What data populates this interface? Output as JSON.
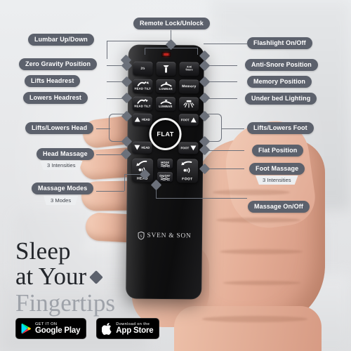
{
  "background": {
    "page_bg": "#e9eaec",
    "accent_pill": "#5c616c"
  },
  "callouts": {
    "top": {
      "label": "Remote Lock/Unlock"
    },
    "left": [
      {
        "label": "Lumbar Up/Down",
        "sub": null
      },
      {
        "label": "Zero Gravity Position",
        "sub": null
      },
      {
        "label": "Lifts Headrest",
        "sub": null
      },
      {
        "label": "Lowers Headrest",
        "sub": null
      },
      {
        "label": "Lifts/Lowers Head",
        "sub": null
      },
      {
        "label": "Head Massage",
        "sub": "3 Intensities"
      },
      {
        "label": "Massage Modes",
        "sub": "3 Modes"
      }
    ],
    "right": [
      {
        "label": "Flashlight On/Off",
        "sub": null
      },
      {
        "label": "Anti-Snore Position",
        "sub": null
      },
      {
        "label": "Memory Position",
        "sub": null
      },
      {
        "label": "Under bed Lighting",
        "sub": null
      },
      {
        "label": "Lifts/Lowers Foot",
        "sub": null
      },
      {
        "label": "Flat Position",
        "sub": null
      },
      {
        "label": "Foot Massage",
        "sub": "3 Intensities"
      },
      {
        "label": "Massage On/Off",
        "sub": null
      }
    ]
  },
  "remote": {
    "lock_indicator": "lock-led",
    "buttons": {
      "zg": "ZG",
      "flashlight": "flashlight-icon",
      "anti_snore_line1": "Anti",
      "anti_snore_line2": "Snore",
      "head_tilt_up": "HEAD TILT",
      "lumbar_up": "LUMBAR",
      "memory": "Memory",
      "head_tilt_down": "HEAD TILT",
      "lumbar_down": "LUMBAR",
      "under_bed_light": "underbed-light-icon",
      "head_up": "HEAD",
      "foot_up": "FOOT",
      "flat": "FLAT",
      "head_down": "HEAD",
      "foot_down": "FOOT",
      "head_massage": "HEAD",
      "mode": "MODE",
      "onoff": "ON/OFF",
      "foot_massage": "FOOT"
    },
    "brand": "SVEN & SON"
  },
  "marketing": {
    "tagline_line1": "Sleep",
    "tagline_line2": "at Your",
    "tagline_line3": "Fingertips",
    "badges": [
      {
        "small": "GET IT ON",
        "big": "Google Play",
        "icon": "google-play-icon"
      },
      {
        "small": "Download on the",
        "big": "App Store",
        "icon": "apple-icon"
      }
    ]
  }
}
